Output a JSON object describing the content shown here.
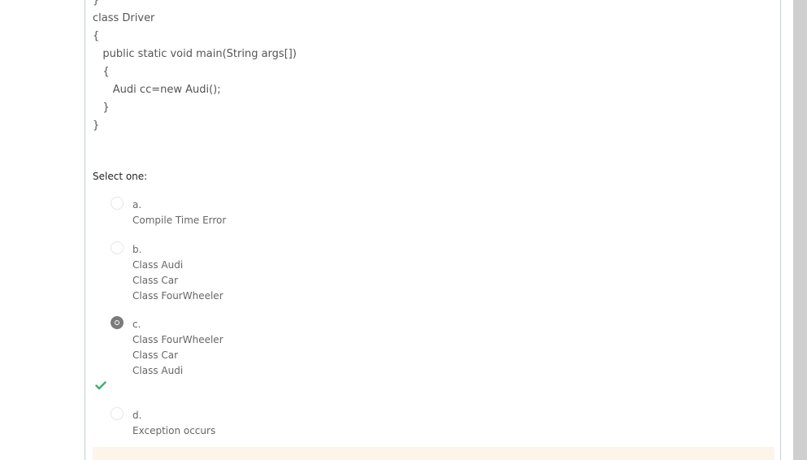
{
  "code": {
    "lines": [
      "}",
      "class Driver",
      "{",
      "   public static void main(String args[])",
      "   {",
      "      Audi cc=new Audi();",
      "   }",
      "}"
    ]
  },
  "question": {
    "prompt": "Select one:",
    "options": [
      {
        "letter": "a.",
        "lines": [
          "Compile Time Error"
        ],
        "selected": false
      },
      {
        "letter": "b.",
        "lines": [
          "Class Audi",
          "Class Car",
          "Class FourWheeler"
        ],
        "selected": false
      },
      {
        "letter": "c.",
        "lines": [
          "Class FourWheeler",
          "Class Car",
          "Class Audi"
        ],
        "selected": true
      },
      {
        "letter": "d.",
        "lines": [
          "Exception occurs"
        ],
        "selected": false
      }
    ]
  },
  "icons": {
    "correct": "check-icon"
  },
  "colors": {
    "correct_check": "#3fae6e",
    "feedback_bg": "#fdf4ea",
    "selected_radio": "#7b7b7b"
  }
}
